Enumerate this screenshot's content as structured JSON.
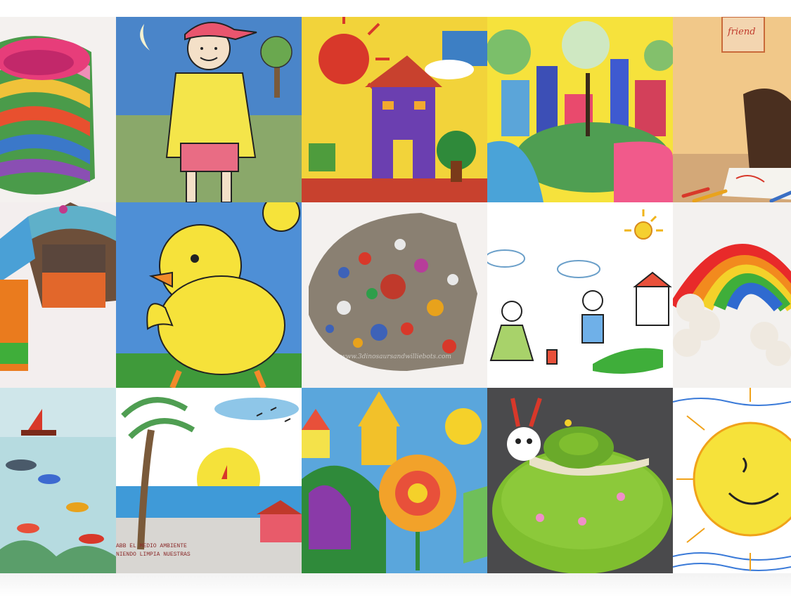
{
  "gallery": {
    "tiles": [
      {
        "name": "rainbow-clay-bowl"
      },
      {
        "name": "boy-drawing"
      },
      {
        "name": "purple-house-painting"
      },
      {
        "name": "colorful-village-painting"
      },
      {
        "name": "child-drawing-photo",
        "sign_text": "friend"
      },
      {
        "name": "clay-birdhouse"
      },
      {
        "name": "yellow-chick-drawing"
      },
      {
        "name": "sequin-clay-fish",
        "watermark": "www.3dinosaursandwilliebots.com"
      },
      {
        "name": "family-stick-drawing"
      },
      {
        "name": "clay-rainbow"
      },
      {
        "name": "ocean-painting"
      },
      {
        "name": "beach-sunset-drawing",
        "caption": "ABB EL MEDIO AMBIENTE\nNIENDO LIMPIA NUESTRAS"
      },
      {
        "name": "houses-flower-painting"
      },
      {
        "name": "clay-snail"
      },
      {
        "name": "sun-drawing"
      }
    ]
  }
}
